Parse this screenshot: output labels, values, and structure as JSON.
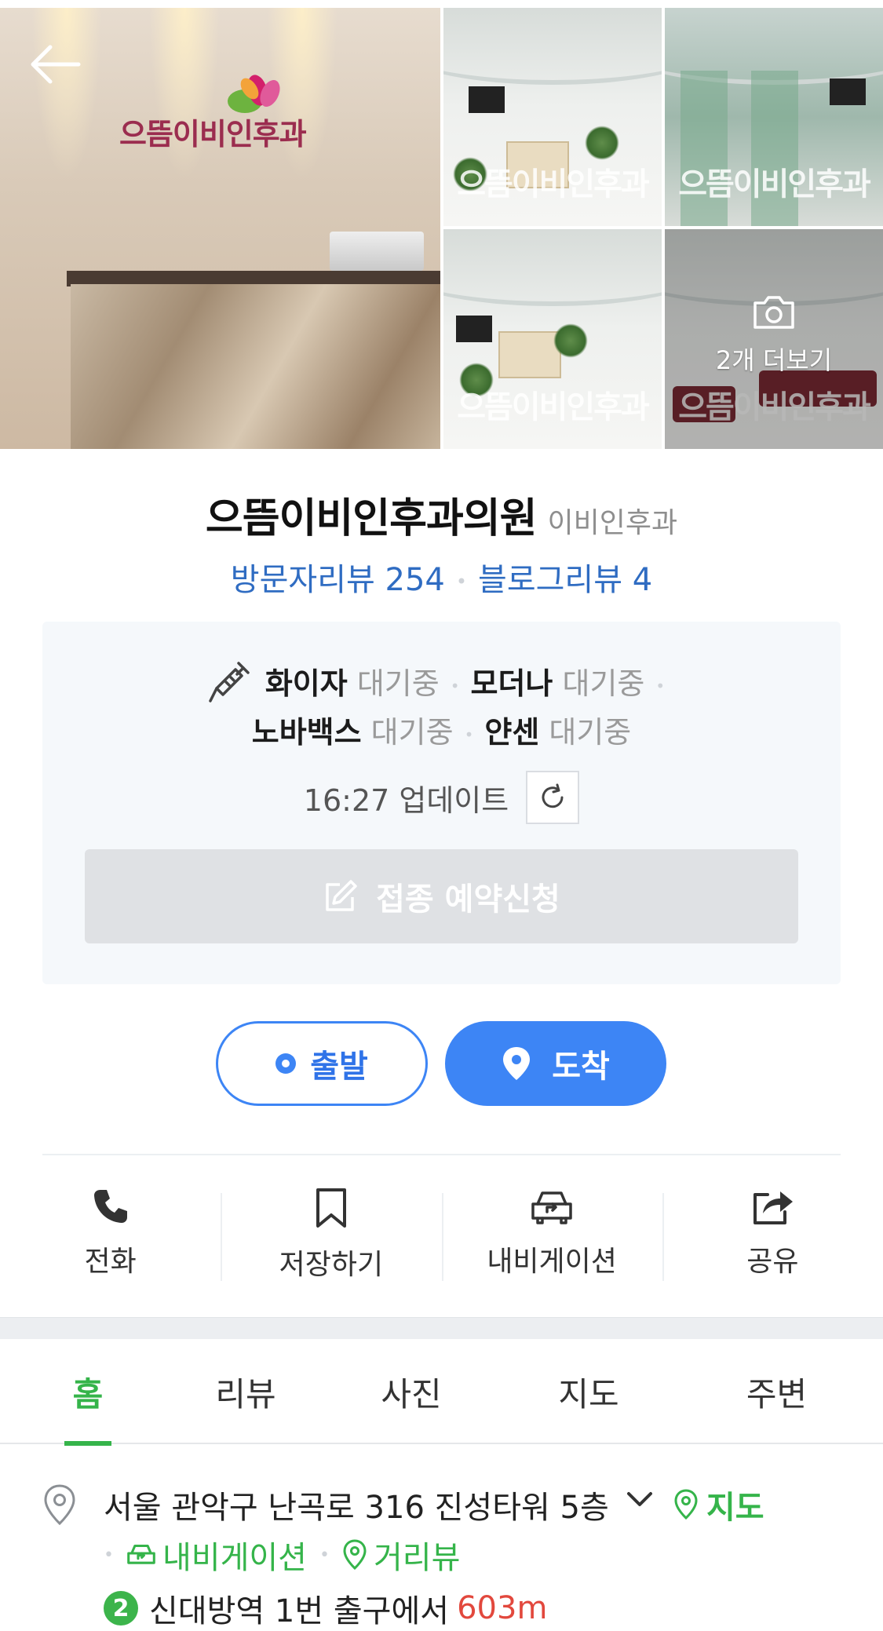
{
  "gallery": {
    "more_label": "2개 더보기",
    "watermark": "으뜸이비인후과",
    "logo_text": "으뜸이비인후과"
  },
  "place": {
    "name": "으뜸이비인후과의원",
    "category": "이비인후과",
    "visitor_reviews": "방문자리뷰 254",
    "blog_reviews": "블로그리뷰 4"
  },
  "vaccine": {
    "items": [
      {
        "name": "화이자",
        "status": "대기중"
      },
      {
        "name": "모더나",
        "status": "대기중"
      },
      {
        "name": "노바백스",
        "status": "대기중"
      },
      {
        "name": "얀센",
        "status": "대기중"
      }
    ],
    "updated": "16:27 업데이트",
    "reserve_label": "접종 예약신청"
  },
  "route": {
    "start_label": "출발",
    "arrive_label": "도착"
  },
  "actions": [
    {
      "label": "전화",
      "icon": "phone-icon"
    },
    {
      "label": "저장하기",
      "icon": "bookmark-icon"
    },
    {
      "label": "내비게이션",
      "icon": "car-navigation-icon"
    },
    {
      "label": "공유",
      "icon": "share-icon"
    }
  ],
  "tabs": [
    {
      "label": "홈",
      "active": true
    },
    {
      "label": "리뷰",
      "active": false
    },
    {
      "label": "사진",
      "active": false
    },
    {
      "label": "지도",
      "active": false
    },
    {
      "label": "주변",
      "active": false
    }
  ],
  "info": {
    "address": "서울 관악구 난곡로 316 진성타워 5층",
    "map_link": "지도",
    "navigation_link": "내비게이션",
    "street_view_link": "거리뷰",
    "subway_line": "2",
    "subway_text": "신대방역 1번 출구에서",
    "subway_distance": "603m"
  },
  "colors": {
    "accent_blue": "#3d85f5",
    "review_blue": "#2f6cc2",
    "naver_green": "#35b44a",
    "distance_red": "#e2483d"
  }
}
